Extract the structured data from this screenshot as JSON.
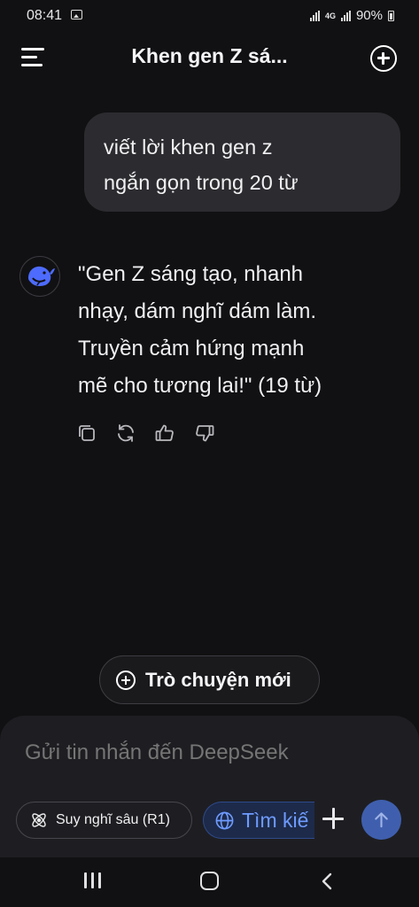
{
  "status_bar": {
    "time": "08:41",
    "network": "4G",
    "battery": "90%"
  },
  "header": {
    "title": "Khen gen Z sá...",
    "menu_icon": "menu-icon",
    "new_chat_icon": "plus-circle-icon"
  },
  "messages": {
    "user": {
      "line1": "viết lời khen gen z",
      "line2": "ngắn gọn trong 20 từ"
    },
    "assistant": {
      "avatar_icon": "deepseek-whale-icon",
      "line1": "\"Gen Z sáng tạo, nhanh",
      "line2": "nhạy, dám nghĩ dám làm.",
      "line3": "Truyền cảm hứng mạnh",
      "line4": "mẽ cho tương lai!\" (19 từ)",
      "actions": [
        "copy-icon",
        "regenerate-icon",
        "thumbs-up-icon",
        "thumbs-down-icon"
      ]
    }
  },
  "new_conversation": {
    "label": "Trò chuyện mới"
  },
  "composer": {
    "placeholder": "Gửi tin nhắn đến DeepSeek",
    "deep_think_label": "Suy nghĩ sâu (R1)",
    "search_label": "Tìm kiế",
    "accent_color": "#3f5fae",
    "search_text_color": "#6e9bff"
  },
  "navbar": {
    "icons": [
      "recent-apps-icon",
      "home-icon",
      "back-icon"
    ]
  }
}
